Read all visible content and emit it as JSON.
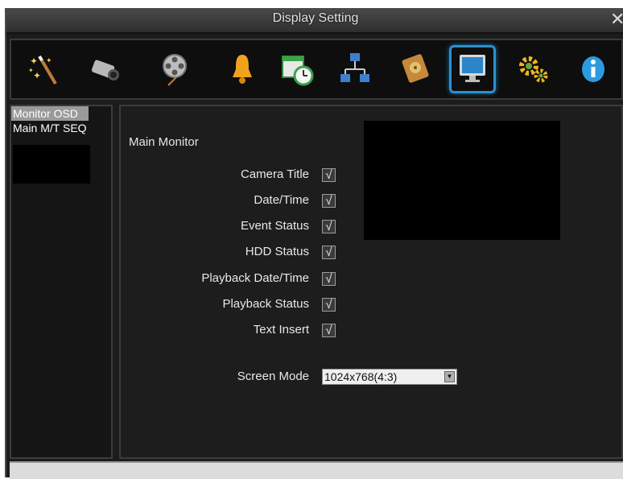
{
  "window": {
    "title": "Display Setting",
    "close_glyph": "✕"
  },
  "toolbar": {
    "items": [
      {
        "icon": "wand-icon"
      },
      {
        "icon": "camera-icon"
      },
      {
        "icon": "film-reel-icon"
      },
      {
        "icon": "bell-icon"
      },
      {
        "icon": "schedule-clock-icon"
      },
      {
        "icon": "network-icon"
      },
      {
        "icon": "hdd-icon"
      },
      {
        "icon": "monitor-icon",
        "selected": true
      },
      {
        "icon": "gears-icon"
      },
      {
        "icon": "info-icon"
      }
    ]
  },
  "sidebar": {
    "items": [
      {
        "label": "Monitor OSD",
        "selected": true
      },
      {
        "label": "Main M/T SEQ",
        "selected": false
      }
    ]
  },
  "main": {
    "section_title": "Main Monitor",
    "options": [
      {
        "label": "Camera Title",
        "checked": true
      },
      {
        "label": "Date/Time",
        "checked": true
      },
      {
        "label": "Event Status",
        "checked": true
      },
      {
        "label": "HDD Status",
        "checked": true
      },
      {
        "label": "Playback Date/Time",
        "checked": true
      },
      {
        "label": "Playback Status",
        "checked": true
      },
      {
        "label": "Text Insert",
        "checked": true
      }
    ],
    "check_glyph": "√",
    "screen_mode": {
      "label": "Screen Mode",
      "value": "1024x768(4:3)"
    }
  },
  "colors": {
    "accent": "#2d8fd0",
    "background": "#1c1c1c",
    "selected_item": "#9a9a9a"
  }
}
